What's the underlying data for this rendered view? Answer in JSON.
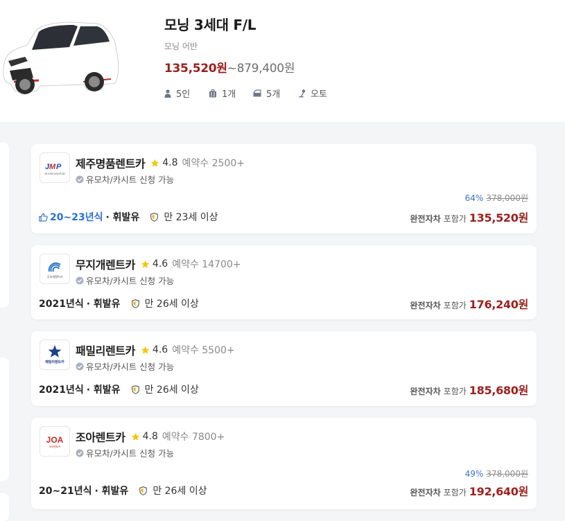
{
  "car": {
    "title": "모닝 3세대 F/L",
    "subtitle": "모닝 어반",
    "price_low": "135,520원",
    "price_high": "~879,400원",
    "specs": [
      {
        "icon": "person-icon",
        "label": "5인"
      },
      {
        "icon": "luggage-icon",
        "label": "1개"
      },
      {
        "icon": "car-door-icon",
        "label": "5개"
      },
      {
        "icon": "gear-shift-icon",
        "label": "오토"
      }
    ]
  },
  "listings": [
    {
      "company": "제주명품렌트카",
      "logo_text": "JMP",
      "logo_sub": "JEJUMYUNGPUM",
      "rating": "4.8",
      "reservations": "예약수 2500+",
      "options": "유모차/카시트 신청 가능",
      "discount_pct": "64%",
      "original_price": "378,000원",
      "year": "20~23년식",
      "fuel": "· 휘발유",
      "age_limit": "만 23세 이상",
      "insurance": "완전자차",
      "included": "포함가",
      "price": "135,520원"
    },
    {
      "company": "무지개렌트카",
      "logo_text": "무지개렌트카",
      "rating": "4.6",
      "reservations": "예약수 14700+",
      "options": "유모차/카시트 신청 가능",
      "year": "2021년식",
      "fuel": "· 휘발유",
      "age_limit": "만 26세 이상",
      "insurance": "완전자차",
      "included": "포함가",
      "price": "176,240원"
    },
    {
      "company": "패밀리렌트카",
      "logo_text": "패밀리렌트카",
      "rating": "4.6",
      "reservations": "예약수 5500+",
      "options": "유모차/카시트 신청 가능",
      "year": "2021년식",
      "fuel": "· 휘발유",
      "age_limit": "만 26세 이상",
      "insurance": "완전자차",
      "included": "포함가",
      "price": "185,680원"
    },
    {
      "company": "조아렌트카",
      "logo_text": "JOA",
      "logo_sub": "조아렌트카",
      "rating": "4.8",
      "reservations": "예약수 7800+",
      "options": "유모차/카시트 신청 가능",
      "discount_pct": "49%",
      "original_price": "378,000원",
      "year": "20~21년식",
      "fuel": "· 휘발유",
      "age_limit": "만 26세 이상",
      "insurance": "완전자차",
      "included": "포함가",
      "price": "192,640원"
    }
  ],
  "colors": {
    "price_red": "#9b1f1c",
    "discount_blue": "#3874c4",
    "star_yellow": "#f7c600",
    "background": "#f4f5f7"
  }
}
